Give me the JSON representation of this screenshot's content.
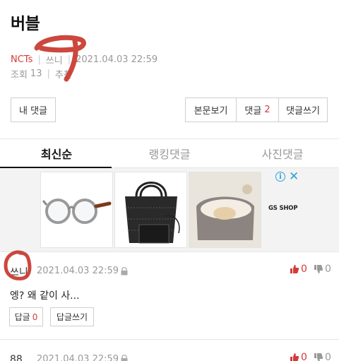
{
  "post": {
    "title": "버블",
    "category": "NCT",
    "category_suffix": "s",
    "author": "쓰니",
    "date": "2021.04.03 22:59",
    "views_label": "조회",
    "views": "13",
    "recommend_label": "추천"
  },
  "buttons": {
    "my_comments": "내 댓글",
    "view_post": "본문보기",
    "comments": "댓글",
    "comments_count": "2",
    "write_comment": "댓글쓰기"
  },
  "tabs": [
    {
      "label": "최신순",
      "active": true
    },
    {
      "label": "랭킹댓글",
      "active": false
    },
    {
      "label": "사진댓글",
      "active": false
    }
  ],
  "ad": {
    "brand": "GS SHOP",
    "info_icon": "i",
    "close_icon": "✕"
  },
  "comments": [
    {
      "author": "쓰니",
      "date": "2021.04.03 22:59",
      "text": "엥? 왜 같이 사...",
      "likes": "0",
      "dislikes": "0",
      "reply_label": "답글",
      "reply_count": "0",
      "write_reply_label": "답글쓰기"
    },
    {
      "author": "88",
      "date": "2021.04.03 22:59",
      "likes": "0",
      "dislikes": "0"
    }
  ],
  "colors": {
    "accent": "#d33b3b",
    "scribble": "#c8372d",
    "ad_icon": "#29a3d8"
  }
}
